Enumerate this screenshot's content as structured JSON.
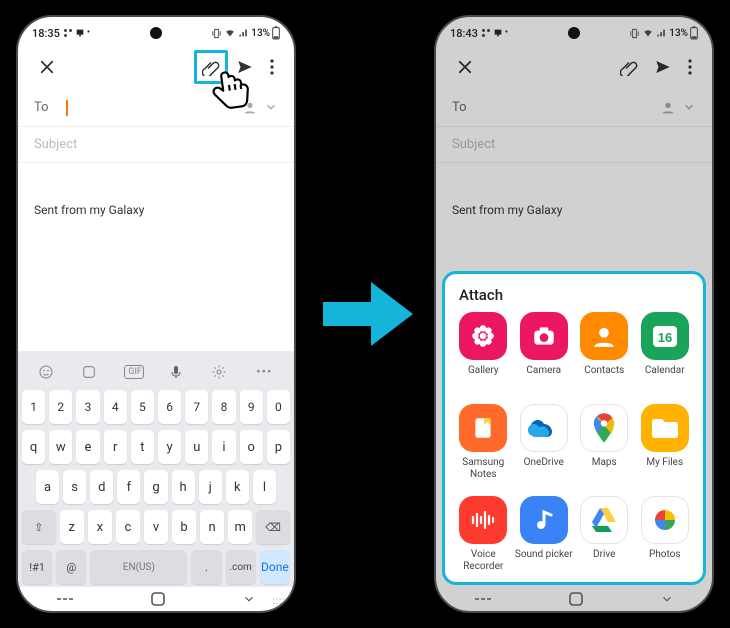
{
  "colors": {
    "highlight": "#13b5d8",
    "arrow": "#13b5d8",
    "cursor": "#ff7a00",
    "done_bg": "#cfe8ff",
    "done_fg": "#1a73e8"
  },
  "left": {
    "status": {
      "time": "18:35",
      "battery": "13%"
    },
    "compose": {
      "to_label": "To",
      "subject_placeholder": "Subject",
      "signature": "Sent from my Galaxy"
    },
    "keyboard": {
      "row_numbers": [
        "1",
        "2",
        "3",
        "4",
        "5",
        "6",
        "7",
        "8",
        "9",
        "0"
      ],
      "row_q": [
        "q",
        "w",
        "e",
        "r",
        "t",
        "y",
        "u",
        "i",
        "o",
        "p"
      ],
      "row_a": [
        "a",
        "s",
        "d",
        "f",
        "g",
        "h",
        "j",
        "k",
        "l"
      ],
      "row_z_leading": "⇧",
      "row_z": [
        "z",
        "x",
        "c",
        "v",
        "b",
        "n",
        "m"
      ],
      "row_z_trailing": "⌫",
      "bottom": {
        "sym": "!#1",
        "at": "@",
        "lang": "EN(US)",
        "dot": ".",
        "com": ".com",
        "done": "Done"
      }
    }
  },
  "right": {
    "status": {
      "time": "18:43",
      "battery": "13%"
    },
    "compose": {
      "to_label": "To",
      "subject_placeholder": "Subject",
      "signature": "Sent from my Galaxy"
    },
    "attach": {
      "title": "Attach",
      "items": [
        {
          "label": "Gallery",
          "bg": "#eb1763",
          "glyph": "flower"
        },
        {
          "label": "Camera",
          "bg": "#eb1763",
          "glyph": "camera"
        },
        {
          "label": "Contacts",
          "bg": "#ff8a00",
          "glyph": "person"
        },
        {
          "label": "Calendar",
          "bg": "#1aa35a",
          "glyph": "cal16"
        },
        {
          "label": "Samsung Notes",
          "bg": "#ff6a2b",
          "glyph": "note"
        },
        {
          "label": "OneDrive",
          "bg": "#ffffff",
          "glyph": "onedrive"
        },
        {
          "label": "Maps",
          "bg": "#ffffff",
          "glyph": "gmaps"
        },
        {
          "label": "My Files",
          "bg": "#ffb300",
          "glyph": "folder"
        },
        {
          "label": "Voice Recorder",
          "bg": "#ff3b30",
          "glyph": "wave"
        },
        {
          "label": "Sound picker",
          "bg": "#3b82f6",
          "glyph": "music"
        },
        {
          "label": "Drive",
          "bg": "#ffffff",
          "glyph": "gdrive"
        },
        {
          "label": "Photos",
          "bg": "#ffffff",
          "glyph": "gphotos"
        }
      ]
    }
  }
}
